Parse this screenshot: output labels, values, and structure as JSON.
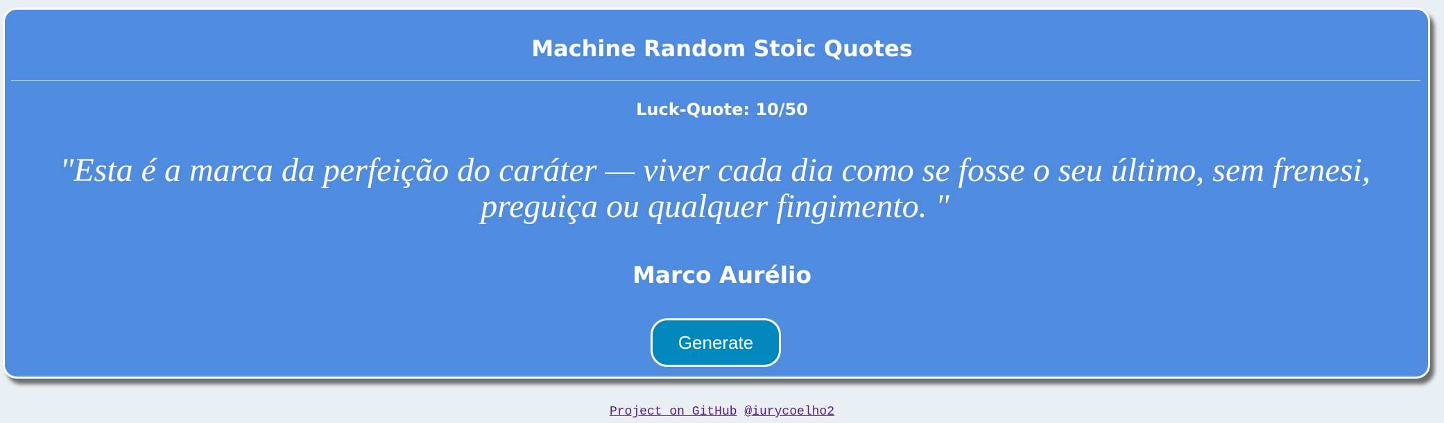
{
  "app": {
    "title": "Machine Random Stoic Quotes"
  },
  "quote_card": {
    "counter": "Luck-Quote: 10/50",
    "quote_text": "\"Esta é a marca da perfeição do caráter — viver cada dia como se fosse o seu último, sem frenesi, preguiça ou qualquer fingimento. \"",
    "author": "Marco Aurélio",
    "generate_label": "Generate"
  },
  "footer": {
    "project_link": "Project on GitHub",
    "author_link": "@iurycoelho2"
  },
  "colors": {
    "card_background": "#4f8ce0",
    "button_background": "#0088bd",
    "page_background": "#eaeff4",
    "link_color": "#551a8b"
  }
}
